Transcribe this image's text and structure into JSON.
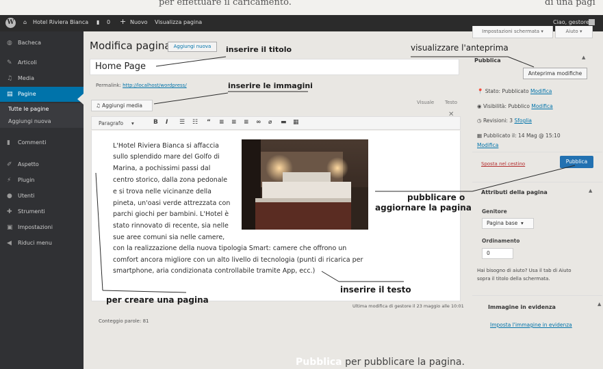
{
  "top_strip": {
    "left_text": "per effettuare il caricamento.",
    "right_text": "di una pagi"
  },
  "admin_bar": {
    "site_name": "Hotel Riviera Bianca",
    "comments_count": "0",
    "new_label": "Nuovo",
    "view_page_label": "Visualizza pagina",
    "greeting": "Ciao, gestore"
  },
  "screen_options": {
    "screen_label": "Impostazioni schermata",
    "help_label": "Aiuto"
  },
  "sidebar": {
    "items": [
      {
        "label": "Bacheca",
        "icon": "dashboard-icon"
      },
      {
        "label": "Articoli",
        "icon": "pin-icon"
      },
      {
        "label": "Media",
        "icon": "media-icon"
      },
      {
        "label": "Pagine",
        "icon": "pages-icon"
      },
      {
        "label": "Commenti",
        "icon": "comment-icon"
      },
      {
        "label": "Aspetto",
        "icon": "brush-icon"
      },
      {
        "label": "Plugin",
        "icon": "plugin-icon"
      },
      {
        "label": "Utenti",
        "icon": "user-icon"
      },
      {
        "label": "Strumenti",
        "icon": "wrench-icon"
      },
      {
        "label": "Impostazioni",
        "icon": "settings-icon"
      },
      {
        "label": "Riduci menu",
        "icon": "collapse-icon"
      }
    ],
    "submenu": [
      "Tutte le pagine",
      "Aggiungi nuova"
    ]
  },
  "editor": {
    "heading": "Modifica pagina",
    "add_new_label": "Aggiungi nuova",
    "title_value": "Home Page",
    "permalink_label": "Permalink:",
    "permalink_url": "http://localhost/wordpress/",
    "add_media_label": "Aggiungi media",
    "tab_visual": "Visuale",
    "tab_text": "Testo",
    "format_select": "Paragrafo",
    "paragraph_lines": [
      "L'Hotel Riviera Bianca si affaccia",
      "sullo splendido mare del Golfo di",
      "Marina, a pochissimi passi dal",
      "centro storico, dalla zona pedonale",
      "e si trova nelle vicinanze della",
      "pineta, un'oasi verde attrezzata con",
      "parchi giochi per bambini. L'Hotel è",
      "stato rinnovato di recente, sia nelle",
      "sue aree comuni sia nelle camere,",
      "con la realizzazione della nuova tipologia Smart: camere che offrono un",
      "comfort ancora migliore con un alto livello di tecnologia (punti di ricarica per",
      "smartphone, aria condizionata controllabile tramite App, ecc.)"
    ],
    "word_count": "Conteggio parole: 81",
    "last_modified": "Ultima modifica di gestore il 23 maggio alle 10:01"
  },
  "publish_box": {
    "title": "Pubblica",
    "preview_button": "Anteprima modifiche",
    "status": "Stato: Pubblicato",
    "visibility": "Visibilità: Pubblico",
    "revisions": "Revisioni: 3",
    "revisions_link": "Sfoglia",
    "published_on": "Pubblicato il: 14 Mag @ 15:10",
    "edit_link": "Modifica",
    "trash_link": "Sposta nel cestino",
    "publish_button": "Pubblica"
  },
  "attributes_box": {
    "title": "Attributi della pagina",
    "parent_label": "Genitore",
    "parent_value": "Pagina base",
    "order_label": "Ordinamento",
    "order_value": "0",
    "help_line1": "Hai bisogno di aiuto? Usa il tab di Aiuto",
    "help_line2": "sopra il titolo della schermata."
  },
  "featured_box": {
    "title": "Immagine in evidenza",
    "link": "Imposta l'immagine in evidenza"
  },
  "annotations": {
    "title": "inserire il titolo",
    "preview": "visualizzare l'anteprima",
    "images": "inserire le immagini",
    "publish_line1": "pubblicare o",
    "publish_line2": "aggiornare la pagina",
    "text": "inserire il testo",
    "create": "per creare una pagina"
  },
  "bottom_caption": {
    "word": "Pubblica",
    "text": "per pubblicare la pagina."
  }
}
